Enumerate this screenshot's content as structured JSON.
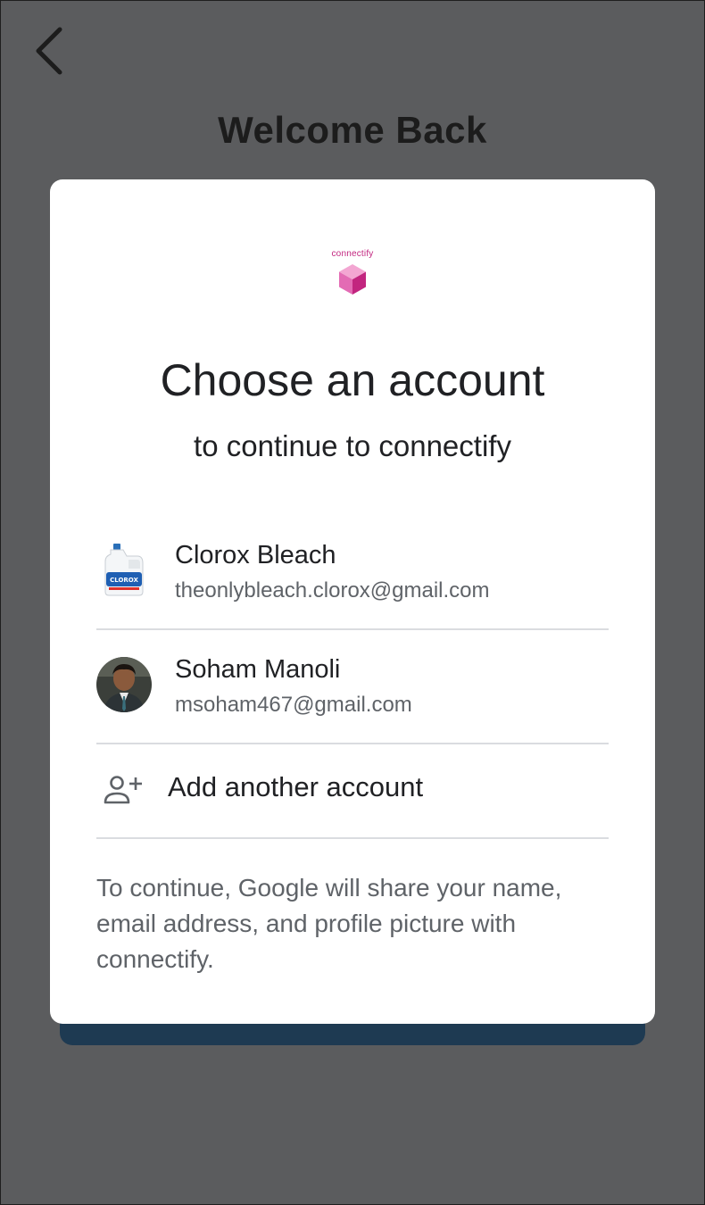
{
  "page": {
    "title": "Welcome Back"
  },
  "icons": {
    "back": "chevron-left-icon",
    "add_account": "person-add-icon"
  },
  "colors": {
    "background": "#5b5c5e",
    "dialog": "#ffffff",
    "hidden_button": "#1e3a52",
    "app_brand": "#c2257f"
  },
  "dialog": {
    "app_logo_text": "connectify",
    "title": "Choose an account",
    "subtitle": "to continue to connectify",
    "accounts": [
      {
        "name": "Clorox Bleach",
        "email": "theonlybleach.clorox@gmail.com"
      },
      {
        "name": "Soham Manoli",
        "email": "msoham467@gmail.com"
      }
    ],
    "add_account_label": "Add another account",
    "consent_text": "To continue, Google will share your name, email address, and profile picture with connectify."
  }
}
